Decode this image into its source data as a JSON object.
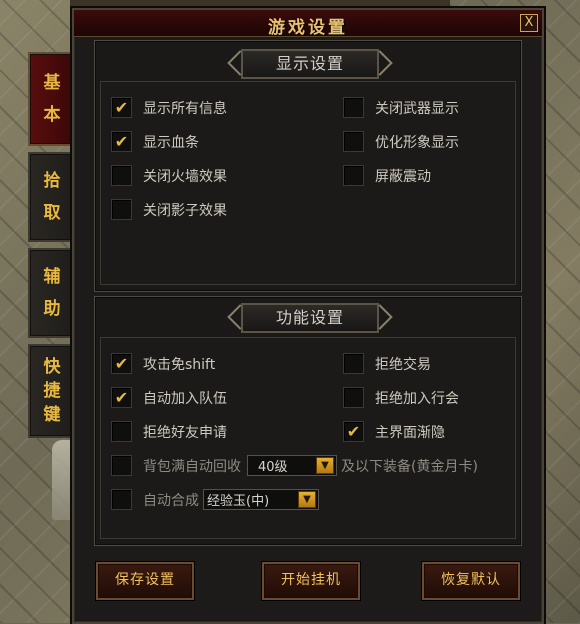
{
  "window": {
    "title": "游戏设置",
    "close_label": "X"
  },
  "tabs": [
    {
      "chars": [
        "基",
        "本"
      ],
      "active": true
    },
    {
      "chars": [
        "拾",
        "取"
      ],
      "active": false
    },
    {
      "chars": [
        "辅",
        "助"
      ],
      "active": false
    },
    {
      "chars": [
        "快",
        "捷",
        "键"
      ],
      "active": false
    }
  ],
  "display_section": {
    "header": "显示设置",
    "options": [
      {
        "label": "显示所有信息",
        "checked": true
      },
      {
        "label": "关闭武器显示",
        "checked": false
      },
      {
        "label": "显示血条",
        "checked": true
      },
      {
        "label": "优化形象显示",
        "checked": false
      },
      {
        "label": "关闭火墙效果",
        "checked": false
      },
      {
        "label": "屏蔽震动",
        "checked": false
      },
      {
        "label": "关闭影子效果",
        "checked": false
      }
    ]
  },
  "function_section": {
    "header": "功能设置",
    "options": [
      {
        "label": "攻击免shift",
        "checked": true
      },
      {
        "label": "拒绝交易",
        "checked": false
      },
      {
        "label": "自动加入队伍",
        "checked": true
      },
      {
        "label": "拒绝加入行会",
        "checked": false
      },
      {
        "label": "拒绝好友申请",
        "checked": false
      },
      {
        "label": "主界面渐隐",
        "checked": true
      },
      {
        "label": "背包满自动回收",
        "checked": false
      },
      {
        "label": "自动合成",
        "checked": false
      }
    ],
    "recycle_level": "40级",
    "recycle_suffix": "及以下装备(黄金月卡)",
    "compose_item": "经验玉(中)"
  },
  "buttons": {
    "save": "保存设置",
    "start": "开始挂机",
    "restore": "恢复默认"
  },
  "check_mark": "✔",
  "dropdown_arrow": "▼"
}
